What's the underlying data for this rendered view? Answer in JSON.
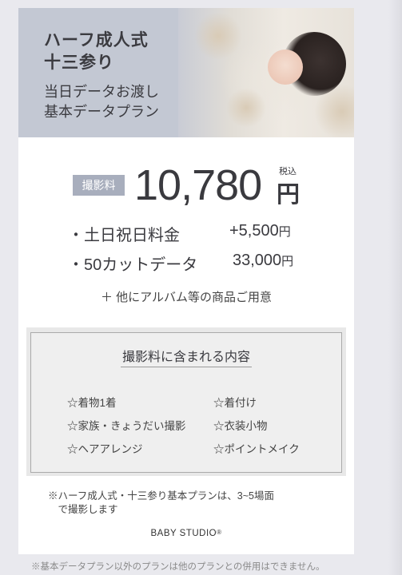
{
  "hero": {
    "title": "ハーフ成人式\n十三参り",
    "subtitle": "当日データお渡し\n基本データプラン"
  },
  "price": {
    "badge": "撮影料",
    "value": "10,780",
    "tax": "税込",
    "yen": "円"
  },
  "options": [
    {
      "label": "・土日祝日料金",
      "amount": "+5,500",
      "yen": "円"
    },
    {
      "label": "・50カットデータ",
      "amount": "33,000",
      "yen": "円"
    }
  ],
  "album_note": "＋ 他にアルバム等の商品ご用意",
  "contents": {
    "title": "撮影料に含まれる内容",
    "items": [
      "☆着物1着",
      "☆着付け",
      "☆家族・きょうだい撮影",
      "☆衣装小物",
      "☆ヘアアレンジ",
      "☆ポイントメイク"
    ]
  },
  "note": "※ハーフ成人式・十三参り基本プランは、3~5場面\n　で撮影します",
  "brand": {
    "name": "BABY STUDIO",
    "mark": "®"
  },
  "footnote": "※基本データプラン以外のプランは他のプランとの併用はできません。"
}
